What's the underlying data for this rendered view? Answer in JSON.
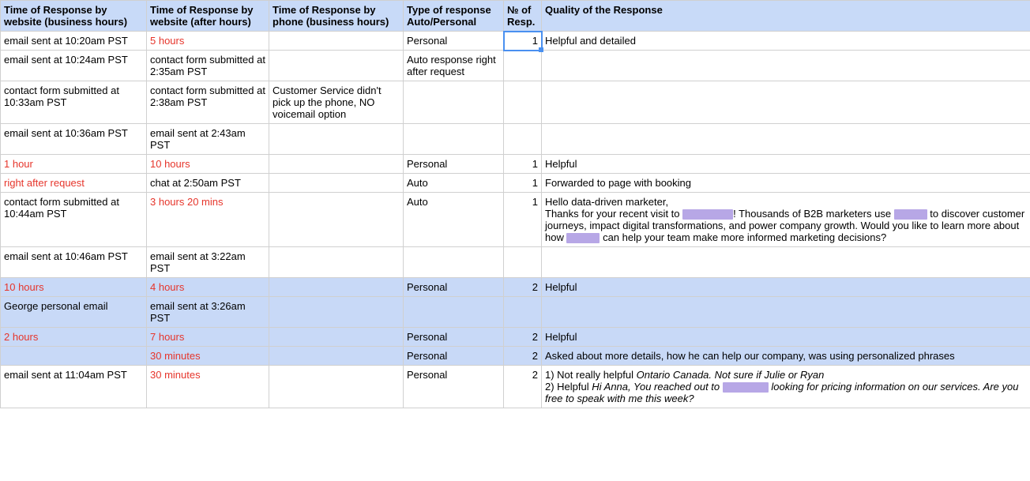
{
  "headers": [
    "Time of Response by website (business hours)",
    "Time of Response by website (after hours)",
    "Time of Response by phone (business hours)",
    "Type of response Auto/Personal",
    "№ of Resp.",
    "Quality of the Response"
  ],
  "rows": [
    {
      "hl": false,
      "c0": {
        "text": "email sent at 10:20am PST"
      },
      "c1": {
        "text": "5 hours",
        "red": true
      },
      "c2": {
        "text": ""
      },
      "c3": {
        "text": "Personal"
      },
      "c4": {
        "text": "1",
        "selected": true
      },
      "c5": {
        "parts": [
          {
            "t": "Helpful and detailed"
          }
        ]
      }
    },
    {
      "hl": false,
      "c0": {
        "text": "email sent at 10:24am PST"
      },
      "c1": {
        "text": "contact form submitted at 2:35am PST"
      },
      "c2": {
        "text": ""
      },
      "c3": {
        "text": "Auto response right after request"
      },
      "c4": {
        "text": ""
      },
      "c5": {
        "parts": []
      }
    },
    {
      "hl": false,
      "c0": {
        "text": "contact form submitted at 10:33am PST"
      },
      "c1": {
        "text": "contact form submitted at 2:38am PST"
      },
      "c2": {
        "text": "Customer Service didn't pick up the phone, NO voicemail option"
      },
      "c3": {
        "text": ""
      },
      "c4": {
        "text": ""
      },
      "c5": {
        "parts": []
      }
    },
    {
      "hl": false,
      "c0": {
        "text": "email sent at 10:36am PST"
      },
      "c1": {
        "text": "email sent at 2:43am PST"
      },
      "c2": {
        "text": ""
      },
      "c3": {
        "text": ""
      },
      "c4": {
        "text": ""
      },
      "c5": {
        "parts": []
      }
    },
    {
      "hl": false,
      "c0": {
        "text": "1 hour",
        "red": true
      },
      "c1": {
        "text": "10 hours",
        "red": true
      },
      "c2": {
        "text": ""
      },
      "c3": {
        "text": "Personal"
      },
      "c4": {
        "text": "1"
      },
      "c5": {
        "parts": [
          {
            "t": "Helpful"
          }
        ]
      }
    },
    {
      "hl": false,
      "c0": {
        "text": "right after request",
        "red": true
      },
      "c1": {
        "text": "chat at 2:50am PST"
      },
      "c2": {
        "text": ""
      },
      "c3": {
        "text": "Auto"
      },
      "c4": {
        "text": "1"
      },
      "c5": {
        "parts": [
          {
            "t": "Forwarded to page with booking"
          }
        ]
      }
    },
    {
      "hl": false,
      "c0": {
        "text": "contact form submitted at 10:44am PST"
      },
      "c1": {
        "text": "3 hours 20 mins",
        "red": true
      },
      "c2": {
        "text": ""
      },
      "c3": {
        "text": "Auto"
      },
      "c4": {
        "text": "1"
      },
      "c5": {
        "parts": [
          {
            "t": "Hello data-driven marketer,"
          },
          {
            "br": true
          },
          {
            "t": "Thanks for your recent visit to "
          },
          {
            "redact": "r1"
          },
          {
            "t": "! Thousands of B2B marketers use "
          },
          {
            "redact": "r2"
          },
          {
            "t": " to discover customer journeys, impact digital transformations, and power company growth. Would you like to learn more about how "
          },
          {
            "redact": "r3"
          },
          {
            "t": " can help your team make more informed marketing decisions?"
          }
        ]
      }
    },
    {
      "hl": false,
      "c0": {
        "text": "email sent at 10:46am PST"
      },
      "c1": {
        "text": "email sent at 3:22am PST"
      },
      "c2": {
        "text": ""
      },
      "c3": {
        "text": ""
      },
      "c4": {
        "text": ""
      },
      "c5": {
        "parts": []
      }
    },
    {
      "hl": true,
      "c0": {
        "text": "10 hours",
        "red": true
      },
      "c1": {
        "text": "4 hours",
        "red": true
      },
      "c2": {
        "text": ""
      },
      "c3": {
        "text": "Personal"
      },
      "c4": {
        "text": "2"
      },
      "c5": {
        "parts": [
          {
            "t": "Helpful"
          }
        ]
      }
    },
    {
      "hl": true,
      "c0": {
        "text": "George personal email"
      },
      "c1": {
        "text": "email sent at 3:26am PST"
      },
      "c2": {
        "text": ""
      },
      "c3": {
        "text": ""
      },
      "c4": {
        "text": ""
      },
      "c5": {
        "parts": []
      }
    },
    {
      "hl": true,
      "c0": {
        "text": "2 hours",
        "red": true
      },
      "c1": {
        "text": "7 hours",
        "red": true
      },
      "c2": {
        "text": ""
      },
      "c3": {
        "text": "Personal"
      },
      "c4": {
        "text": "2"
      },
      "c5": {
        "parts": [
          {
            "t": "Helpful"
          }
        ]
      }
    },
    {
      "hl": true,
      "c0": {
        "text": ""
      },
      "c1": {
        "text": "30 minutes",
        "red": true
      },
      "c2": {
        "text": ""
      },
      "c3": {
        "text": "Personal"
      },
      "c4": {
        "text": "2"
      },
      "c5": {
        "parts": [
          {
            "t": "Asked about more details, how he can help our company, was using personalized phrases"
          }
        ]
      }
    },
    {
      "hl": false,
      "c0": {
        "text": "email sent at 11:04am PST"
      },
      "c1": {
        "text": "30 minutes",
        "red": true
      },
      "c2": {
        "text": ""
      },
      "c3": {
        "text": "Personal"
      },
      "c4": {
        "text": "2"
      },
      "c5": {
        "parts": [
          {
            "t": "1) Not really helpful "
          },
          {
            "t": "Ontario Canada. Not sure if Julie or Ryan",
            "i": true
          },
          {
            "br": true
          },
          {
            "t": "2) Helpful "
          },
          {
            "t": "Hi Anna, You reached out to ",
            "i": true
          },
          {
            "redact": "r4",
            "i": true
          },
          {
            "t": " looking for pricing information on our services. Are you free to speak with me this week?",
            "i": true
          }
        ]
      }
    }
  ]
}
